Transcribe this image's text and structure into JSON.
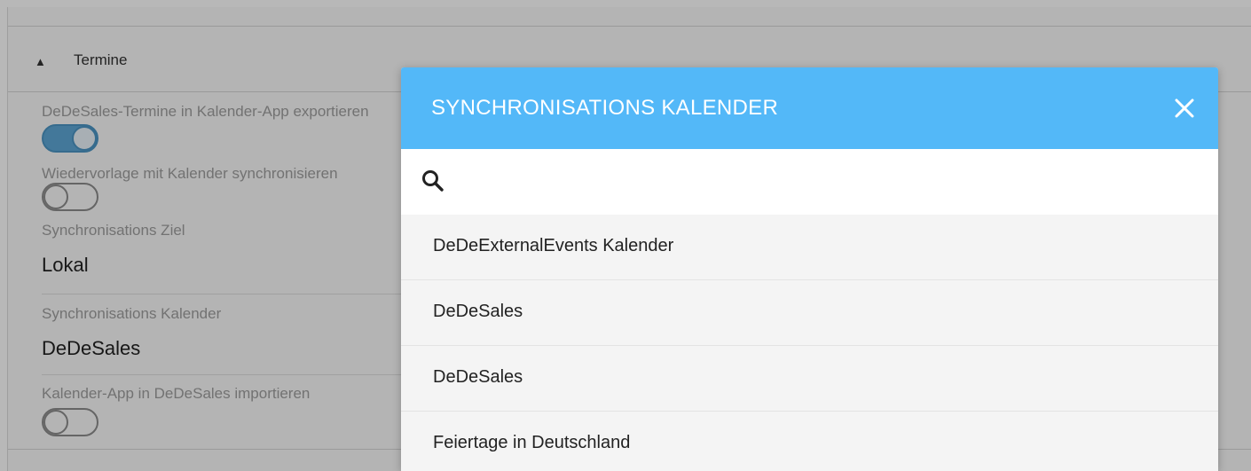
{
  "section": {
    "title": "Termine"
  },
  "settings": {
    "export_label": "DeDeSales-Termine in Kalender-App exportieren",
    "export_enabled": true,
    "resubmission_label": "Wiedervorlage mit Kalender synchronisieren",
    "resubmission_enabled": false,
    "target_label": "Synchronisations Ziel",
    "target_value": "Lokal",
    "calendar_label": "Synchronisations Kalender",
    "calendar_value": "DeDeSales",
    "import_label": "Kalender-App in DeDeSales importieren",
    "import_enabled": false
  },
  "dialog": {
    "title": "SYNCHRONISATIONS KALENDER",
    "search_value": "",
    "search_placeholder": "",
    "items": [
      {
        "label": "DeDeExternalEvents Kalender"
      },
      {
        "label": "DeDeSales"
      },
      {
        "label": "DeDeSales"
      },
      {
        "label": "Feiertage in Deutschland"
      }
    ]
  },
  "colors": {
    "header_blue": "#53b8f8",
    "toggle_on": "#5da7d6"
  },
  "icons": {
    "caret": "caret-up-icon",
    "search": "search-icon",
    "close": "close-icon"
  }
}
